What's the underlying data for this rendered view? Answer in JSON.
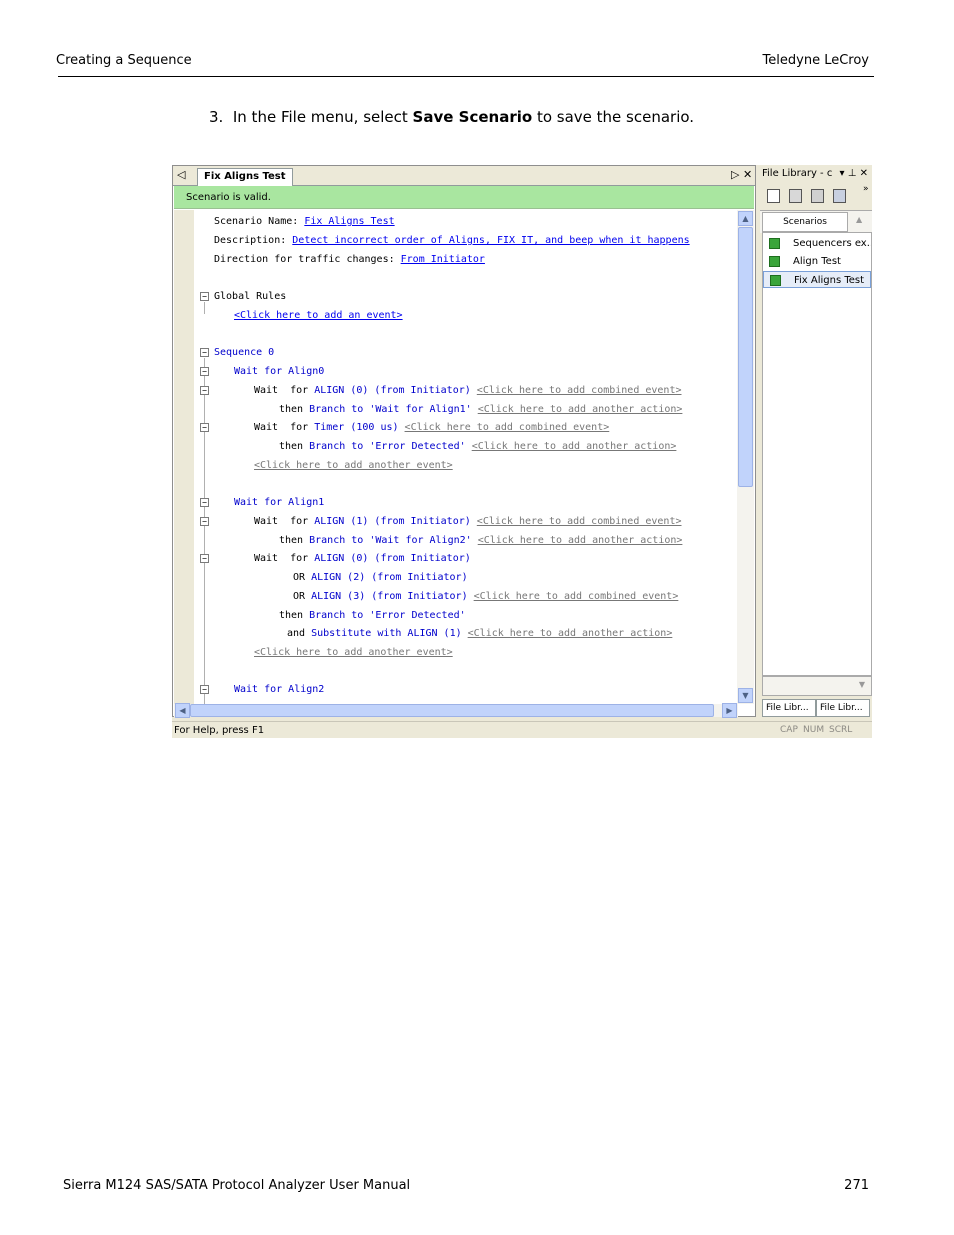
{
  "header": {
    "left": "Creating a Sequence",
    "right": "Teledyne  LeCroy"
  },
  "step": {
    "number": "3.",
    "pre": "In the File menu, select ",
    "bold": "Save Scenario",
    "post": " to save the scenario."
  },
  "footer": {
    "left": "Sierra M124 SAS/SATA Protocol Analyzer User Manual",
    "page": "271"
  },
  "screenshot": {
    "doc_tab": "Fix Aligns Test",
    "tab_left_icon": "◁",
    "tab_right_icon": "▷",
    "tab_close_icon": "✕",
    "validation_message": "Scenario is valid.",
    "code": {
      "l1_label": "Scenario Name: ",
      "l1_value": "Fix Aligns Test",
      "l2_label": "Description: ",
      "l2_value": "Detect incorrect order of Aligns, FIX IT, and beep when it happens",
      "l3_label": "Direction for traffic changes: ",
      "l3_value": "From Initiator",
      "global_rules": "Global Rules",
      "add_event": "<Click here to add an event>",
      "sequence0": "Sequence 0",
      "wait_align0": "Wait for Align0",
      "wf1_pre": "Wait  for ",
      "wf1_kw": "ALIGN (0) (from Initiator)",
      "wf1_hint": "<Click here to add combined event>",
      "th1_pre": "then ",
      "th1_kw": "Branch to 'Wait for Align1'",
      "th1_hint": "<Click here to add another action>",
      "wf2_pre": "Wait  for ",
      "wf2_kw": "Timer (100 us)",
      "wf2_hint": "<Click here to add combined event>",
      "th2_pre": "then ",
      "th2_kw": "Branch to 'Error Detected'",
      "th2_hint": "<Click here to add another action>",
      "add_another_event1": "<Click here to add another event>",
      "wait_align1": "Wait for Align1",
      "wf3_pre": "Wait  for ",
      "wf3_kw": "ALIGN (1) (from Initiator)",
      "wf3_hint": "<Click here to add combined event>",
      "th3_pre": "then ",
      "th3_kw": "Branch to 'Wait for Align2'",
      "th3_hint": "<Click here to add another action>",
      "wf4_pre": "Wait  for ",
      "wf4_kw": "ALIGN (0) (from Initiator)",
      "or1_pre": "OR ",
      "or1_kw": "ALIGN (2) (from Initiator)",
      "or2_pre": "OR ",
      "or2_kw": "ALIGN (3) (from Initiator)",
      "or2_hint": "<Click here to add combined event>",
      "th4_pre": "then ",
      "th4_kw": "Branch to 'Error Detected'",
      "and_pre": "and ",
      "and_kw": "Substitute with ALIGN (1)",
      "and_hint": "<Click here to add another action>",
      "add_another_event2": "<Click here to add another event>",
      "wait_align2": "Wait for Align2"
    },
    "panel": {
      "title": "File Library - c",
      "title_icons": "▾ ⊥ ✕",
      "overflow": "»",
      "column": "Scenarios",
      "items": [
        "Sequencers ex...",
        "Align Test",
        "Fix Aligns Test"
      ],
      "bottom_tabs": [
        "File Libr...",
        "File Libr..."
      ]
    },
    "status": {
      "help": "For Help, press F1",
      "cap": "CAP",
      "num": "NUM",
      "scrl": "SCRL"
    }
  }
}
